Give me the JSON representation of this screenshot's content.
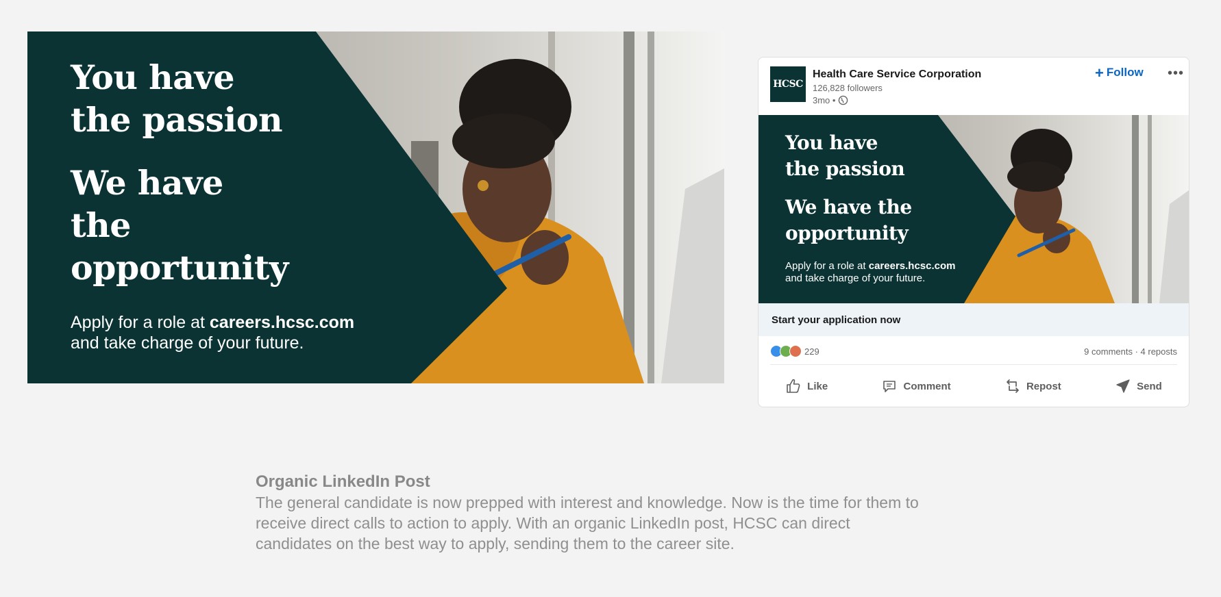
{
  "banner": {
    "headline_1": "You have the passion",
    "headline_2": "We have the opportunity",
    "apply_prefix": "Apply for a role at ",
    "apply_link": "careers.hcsc.com",
    "apply_suffix": "and take charge of your future."
  },
  "post": {
    "logo_text": "HCSC",
    "org_name": "Health Care Service Corporation",
    "followers": "126,828 followers",
    "time_ago": "3mo •",
    "follow_label": "Follow",
    "more_label": "•••",
    "image": {
      "headline_1": "You have the passion",
      "headline_2": "We have the opportunity",
      "apply_prefix": "Apply for a role at ",
      "apply_link": "careers.hcsc.com",
      "apply_suffix": "and take charge of your future."
    },
    "cta": "Start your application now",
    "reaction_count": "229",
    "comments_reposts": "9 comments · 4 reposts",
    "actions": {
      "like": "Like",
      "comment": "Comment",
      "repost": "Repost",
      "send": "Send"
    }
  },
  "description": {
    "title": "Organic LinkedIn Post",
    "body": "The general candidate is now prepped with interest and knowledge. Now is the time for them to receive direct calls to action to apply. With an organic LinkedIn post, HCSC can direct candidates on the best way to apply, sending them to the career site."
  },
  "colors": {
    "brand_dark_green": "#0b3333",
    "linkedin_blue": "#0a66c2",
    "sweater_orange": "#d9901f",
    "page_background": "#f3f3f3"
  }
}
